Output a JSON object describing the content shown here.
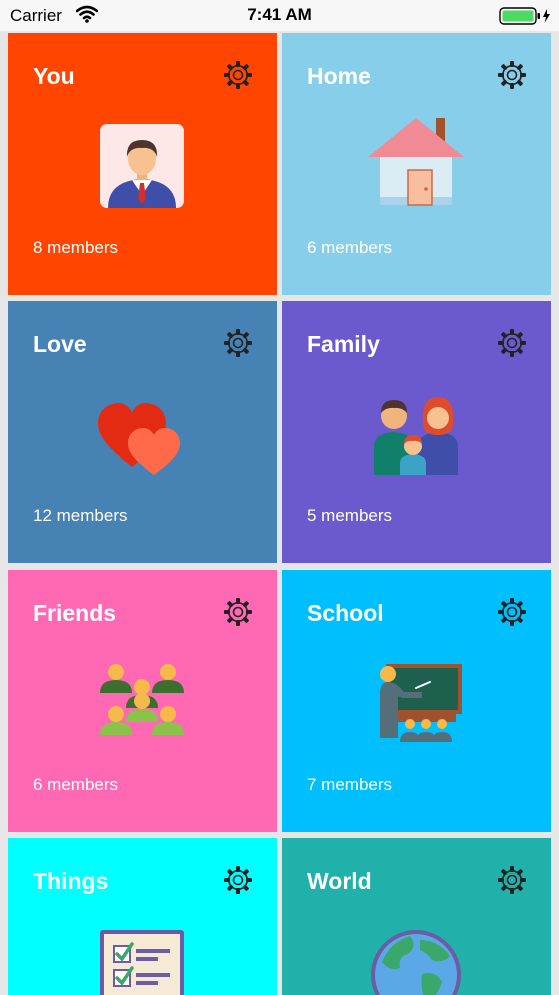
{
  "status_bar": {
    "carrier": "Carrier",
    "time": "7:41 AM"
  },
  "groups": [
    {
      "title": "You",
      "members": "8 members",
      "color": "#ff4500",
      "icon": "person-avatar-icon"
    },
    {
      "title": "Home",
      "members": "6 members",
      "color": "#87ceeb",
      "icon": "house-icon"
    },
    {
      "title": "Love",
      "members": "12 members",
      "color": "#4682b4",
      "icon": "hearts-icon"
    },
    {
      "title": "Family",
      "members": "5 members",
      "color": "#6a5acd",
      "icon": "family-icon"
    },
    {
      "title": "Friends",
      "members": "6 members",
      "color": "#ff69b4",
      "icon": "friends-group-icon"
    },
    {
      "title": "School",
      "members": "7 members",
      "color": "#00bfff",
      "icon": "classroom-icon"
    },
    {
      "title": "Things",
      "members": "",
      "color": "#00ffff",
      "icon": "checklist-icon"
    },
    {
      "title": "World",
      "members": "",
      "color": "#20b2aa",
      "icon": "globe-icon"
    }
  ]
}
